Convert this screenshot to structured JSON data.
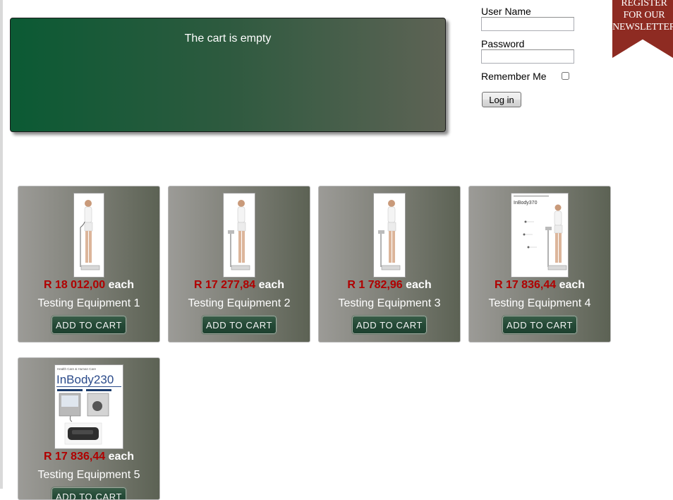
{
  "cart": {
    "empty_text": "The cart is empty"
  },
  "login": {
    "username_label": "User Name",
    "username_value": "",
    "password_label": "Password",
    "password_value": "",
    "remember_label": "Remember Me",
    "remember_checked": false,
    "login_button": "Log in"
  },
  "newsletter": {
    "text": "REGISTER FOR OUR NEWSLETTER"
  },
  "products": [
    {
      "price": "R 18 012,00",
      "each": "each",
      "name": "Testing Equipment 1",
      "button": "ADD TO CART"
    },
    {
      "price": "R 17 277,84",
      "each": "each",
      "name": "Testing Equipment 2",
      "button": "ADD TO CART"
    },
    {
      "price": "R 1 782,96",
      "each": "each",
      "name": "Testing Equipment 3",
      "button": "ADD TO CART"
    },
    {
      "price": "R 17 836,44",
      "each": "each",
      "name": "Testing Equipment 4",
      "button": "ADD TO CART"
    },
    {
      "price": "R 17 836,44",
      "each": "each",
      "name": "Testing Equipment 5",
      "button": "ADD TO CART"
    }
  ],
  "images": {
    "product4_logo": "InBody370",
    "product5_header": "Health Care & Human Care",
    "product5_logo": "InBody230"
  },
  "colors": {
    "price": "#b00000",
    "ribbon": "#8e2b22",
    "cart_bg_start": "#0b5a34"
  }
}
